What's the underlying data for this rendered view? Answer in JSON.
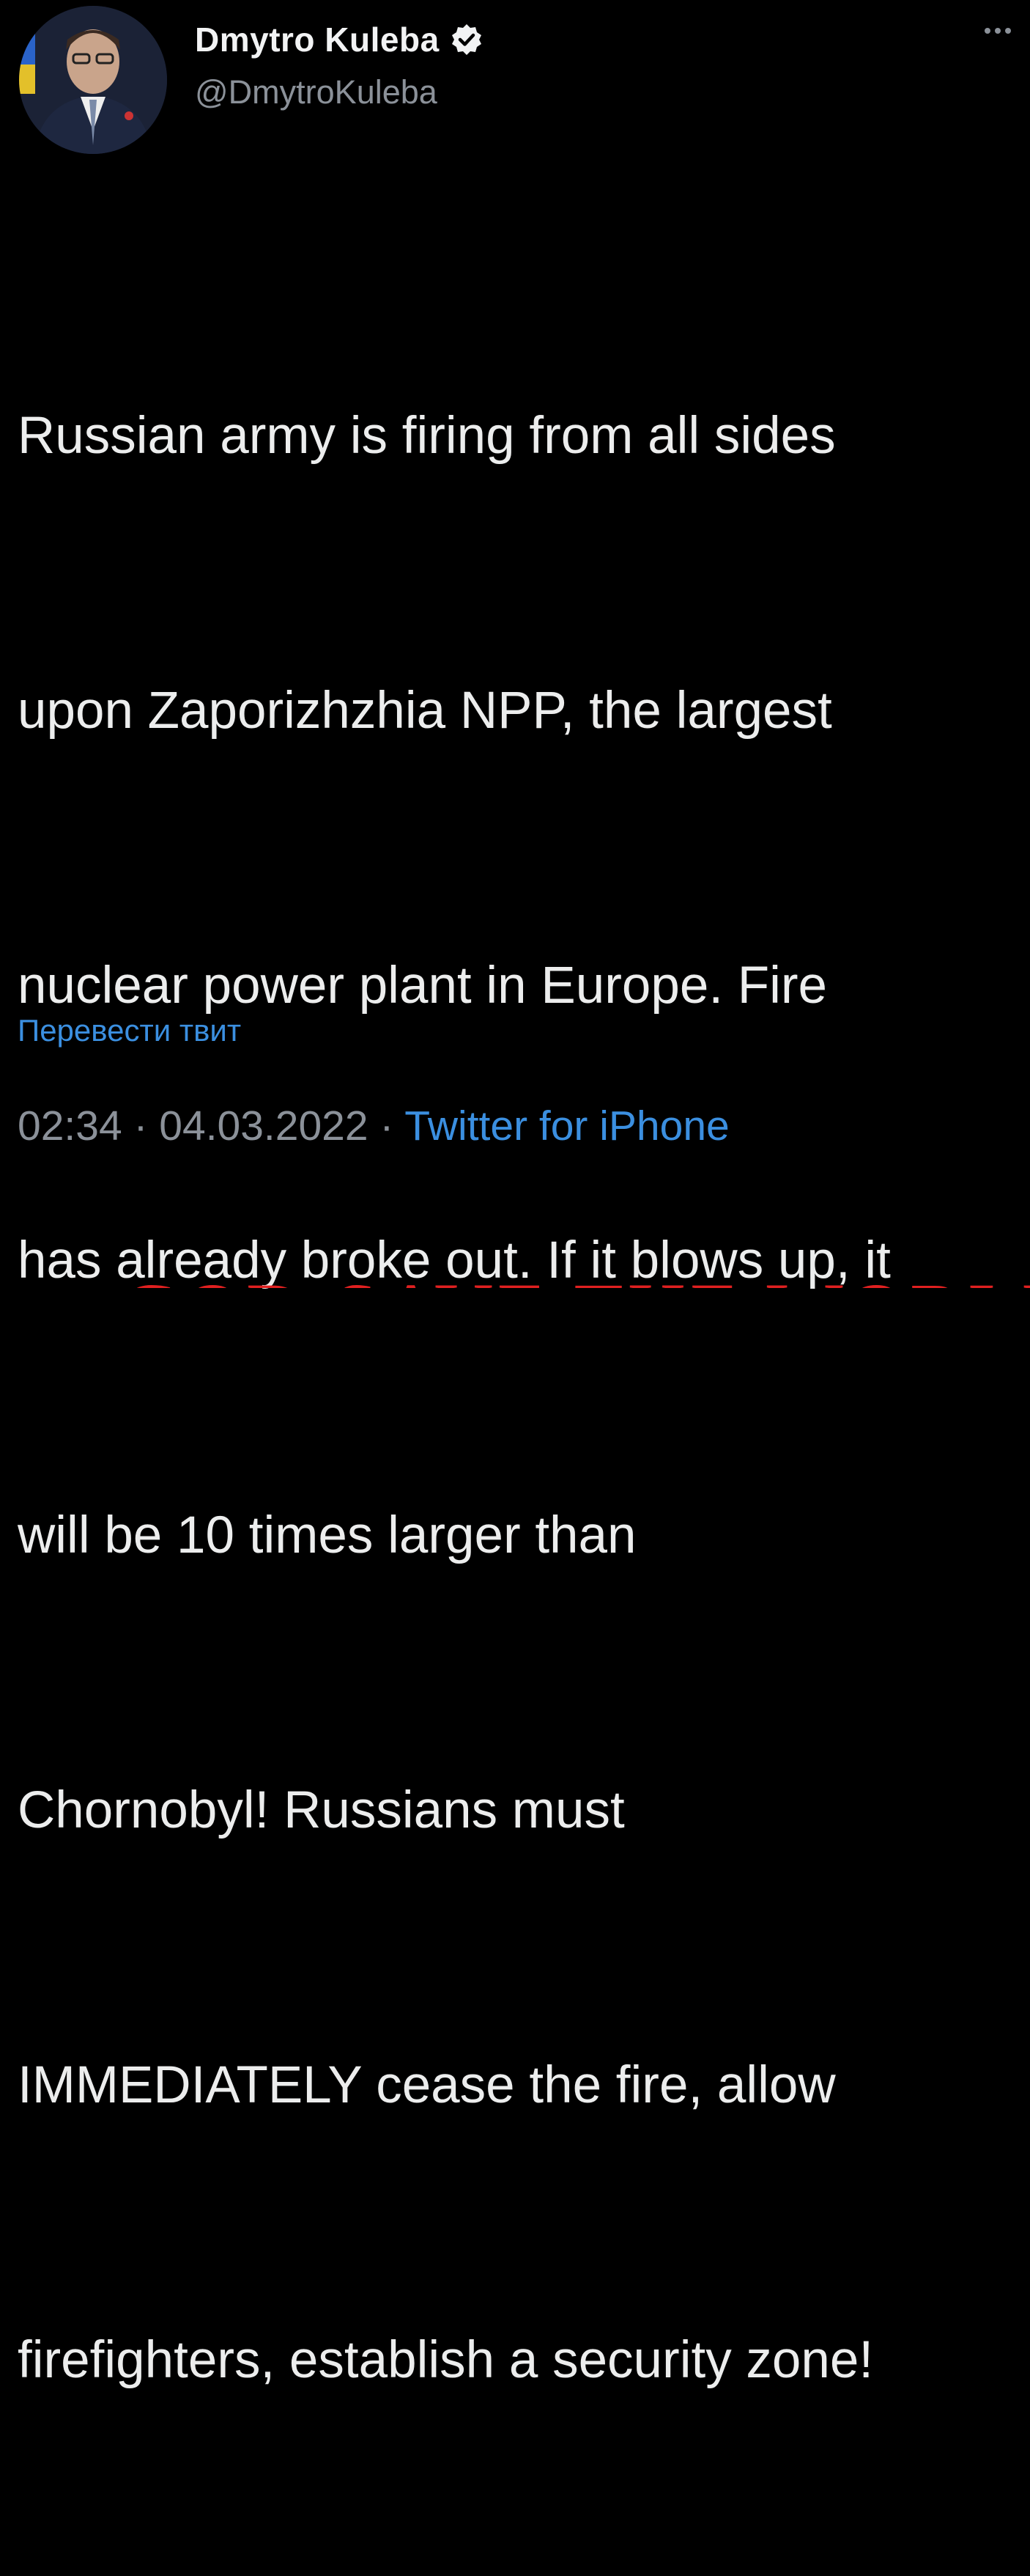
{
  "tweet": {
    "author": {
      "display_name": "Dmytro Kuleba",
      "handle": "@DmytroKuleba",
      "verified_icon": "verified-badge-icon"
    },
    "body_lines": [
      "Russian army is firing from all sides",
      "upon Zaporizhzhia NPP, the largest",
      "nuclear power plant in Europe. Fire",
      "has already broke out. If it blows up, it",
      "will be 10 times larger than",
      "Chornobyl! Russians must",
      "IMMEDIATELY cease the fire, allow",
      "firefighters, establish a security zone!"
    ],
    "translate_label": "Перевести твит",
    "time": "02:34",
    "separator": " · ",
    "date": "04.03.2022",
    "source": "Twitter for iPhone",
    "more_icon": "more-options-icon"
  },
  "banner": {
    "text": "GOD SAVE THE WORLD"
  },
  "colors": {
    "background": "#000000",
    "link": "#3b8fe0",
    "secondary_text": "#8b9199",
    "banner": "#e02020"
  }
}
